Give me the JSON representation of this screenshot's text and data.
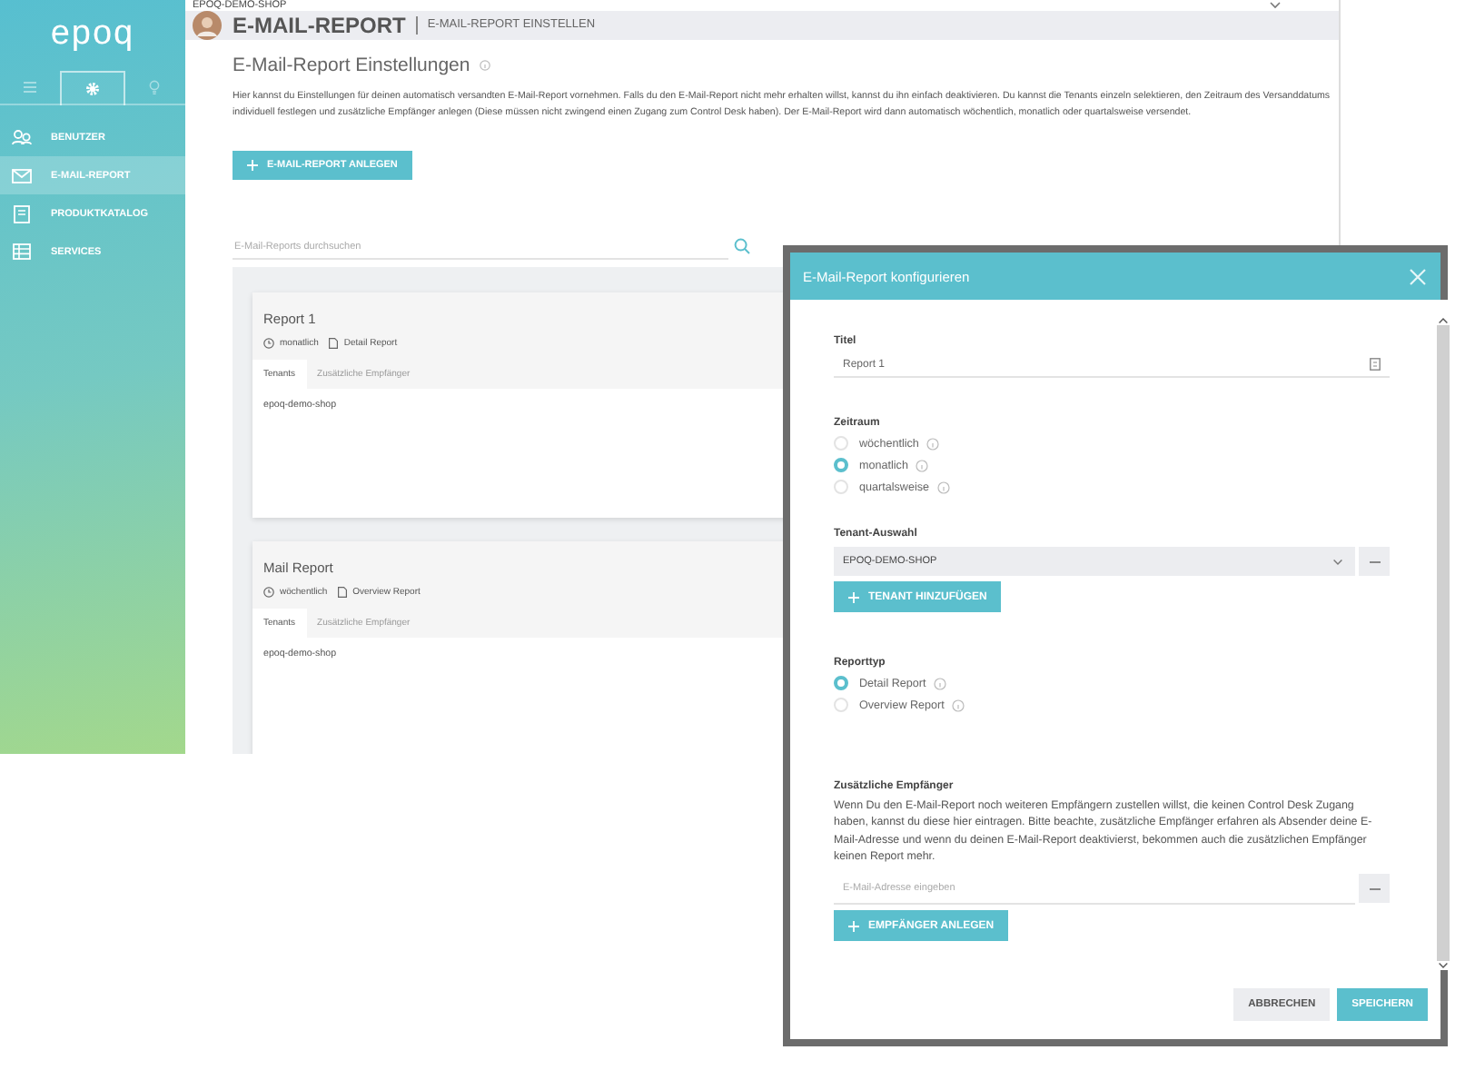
{
  "sidebar": {
    "logo": "epoq",
    "tabs": [
      {
        "kind": "menu",
        "selected": false
      },
      {
        "kind": "settings",
        "selected": true
      },
      {
        "kind": "bulb",
        "selected": false
      }
    ],
    "items": [
      {
        "kind": "users",
        "label": "BENUTZER",
        "selected": false
      },
      {
        "kind": "mail",
        "label": "E-MAIL-REPORT",
        "selected": true
      },
      {
        "kind": "book",
        "label": "PRODUKTKATALOG",
        "selected": false
      },
      {
        "kind": "table",
        "label": "SERVICES",
        "selected": false
      }
    ]
  },
  "top_bar": {
    "shop": "EPOQ-DEMO-SHOP"
  },
  "header": {
    "title": "E-MAIL-REPORT",
    "subtitle": "E-MAIL-REPORT EINSTELLEN"
  },
  "page": {
    "heading": "E-Mail-Report Einstellungen",
    "description": "Hier kannst du Einstellungen für deinen automatisch versandten E-Mail-Report vornehmen. Falls du den E-Mail-Report nicht mehr erhalten willst, kannst du ihn einfach deaktivieren. Du kannst die Tenants einzeln selektieren, den Zeitraum des Versanddatums individuell festlegen und zusätzliche Empfänger anlegen (Diese müssen nicht zwingend einen Zugang zum Control Desk haben). Der E-Mail-Report wird dann automatisch wöchentlich, monatlich oder quartalsweise versendet.",
    "create_button": "E-MAIL-REPORT ANLEGEN",
    "search": {
      "placeholder": "E-Mail-Reports durchsuchen"
    }
  },
  "reports": [
    {
      "title": "Report 1",
      "interval": "monatlich",
      "type": "Detail Report",
      "tabs": [
        {
          "label": "Tenants",
          "selected": true
        },
        {
          "label": "Zusätzliche Empfänger",
          "selected": false
        }
      ],
      "tenants": [
        "epoq-demo-shop"
      ]
    },
    {
      "title": "Mail Report",
      "interval": "wöchentlich",
      "type": "Overview Report",
      "tabs": [
        {
          "label": "Tenants",
          "selected": true
        },
        {
          "label": "Zusätzliche Empfänger",
          "selected": false
        }
      ],
      "tenants": [
        "epoq-demo-shop"
      ]
    }
  ],
  "modal": {
    "title": "E-Mail-Report konfigurieren",
    "title_label": "Titel",
    "title_value": "Report 1",
    "period_label": "Zeitraum",
    "periods": [
      {
        "label": "wöchentlich",
        "selected": false
      },
      {
        "label": "monatlich",
        "selected": true
      },
      {
        "label": "quartalsweise",
        "selected": false
      }
    ],
    "tenant_label": "Tenant-Auswahl",
    "tenant_value": "EPOQ-DEMO-SHOP",
    "add_tenant": "TENANT HINZUFÜGEN",
    "type_label": "Reporttyp",
    "types": [
      {
        "label": "Detail Report",
        "selected": true
      },
      {
        "label": "Overview Report",
        "selected": false
      }
    ],
    "recipients_label": "Zusätzliche Empfänger",
    "recipients_text": "Wenn Du den E-Mail-Report noch weiteren Empfängern zustellen willst, die keinen Control Desk Zugang haben, kannst du diese hier eintragen. Bitte beachte, zusätzliche Empfänger erfahren als Absender deine E-Mail-Adresse und wenn du deinen E-Mail-Report deaktivierst, bekommen auch die zusätzlichen Empfänger keinen Report mehr.",
    "email_placeholder": "E-Mail-Adresse eingeben",
    "add_recipient": "EMPFÄNGER ANLEGEN",
    "buttons": [
      {
        "kind": "cancel",
        "label": "ABBRECHEN"
      },
      {
        "kind": "save",
        "label": "SPEICHERN"
      }
    ]
  }
}
